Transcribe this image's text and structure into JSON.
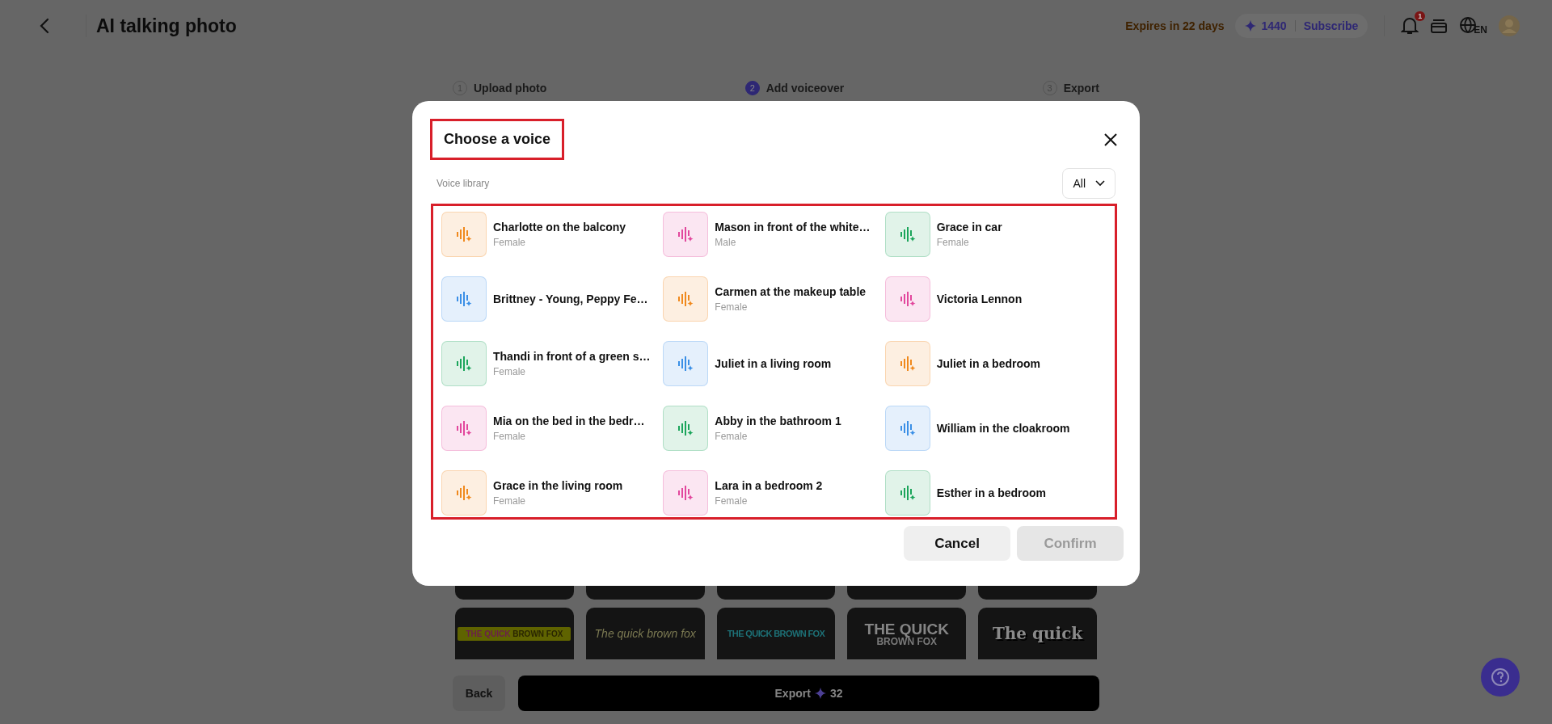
{
  "header": {
    "title": "AI talking photo",
    "expiry": "Expires in 22 days",
    "credits": "1440",
    "subscribe": "Subscribe",
    "notification_count": "1",
    "language": "EN"
  },
  "steps": [
    {
      "number": "1",
      "label": "Upload photo",
      "selected": false
    },
    {
      "number": "2",
      "label": "Add voiceover",
      "selected": true
    },
    {
      "number": "3",
      "label": "Export",
      "selected": false
    }
  ],
  "style_presets": [
    {
      "kind": "highlight",
      "lines": [
        "THE QUICK",
        "BROWN FOX"
      ]
    },
    {
      "kind": "italic",
      "lines": [
        "The quick brown fox"
      ]
    },
    {
      "kind": "condensed",
      "lines": [
        "THE QUICK BROWN FOX"
      ]
    },
    {
      "kind": "stacked",
      "lines": [
        "THE QUICK",
        "BROWN FOX"
      ]
    },
    {
      "kind": "heavy",
      "lines": [
        "The quick"
      ]
    }
  ],
  "back": "Back",
  "export": {
    "label": "Export",
    "cost": "32"
  },
  "dialog": {
    "title": "Choose a voice",
    "library_label": "Voice library",
    "filter": "All",
    "voices": [
      {
        "name": "Charlotte on the balcony",
        "gender": "Female",
        "color": "#f0891d"
      },
      {
        "name": "Mason in front of the white…",
        "gender": "Male",
        "color": "#e2479d"
      },
      {
        "name": "Grace in car",
        "gender": "Female",
        "color": "#1ba55b"
      },
      {
        "name": "Brittney - Young, Peppy Fe…",
        "color": "#3a8fe6"
      },
      {
        "name": "Carmen at the makeup table",
        "gender": "Female",
        "color": "#f0891d"
      },
      {
        "name": "Victoria Lennon",
        "color": "#e2479d"
      },
      {
        "name": "Thandi in front of a green s…",
        "gender": "Female",
        "color": "#1ba55b"
      },
      {
        "name": "Juliet in a living room",
        "color": "#3a8fe6"
      },
      {
        "name": "Juliet in a bedroom",
        "color": "#f0891d"
      },
      {
        "name": "Mia on the bed in the bedr…",
        "gender": "Female",
        "color": "#e2479d"
      },
      {
        "name": "Abby in the bathroom 1",
        "gender": "Female",
        "color": "#1ba55b"
      },
      {
        "name": "William in the cloakroom",
        "color": "#3a8fe6"
      },
      {
        "name": "Grace in the living room",
        "gender": "Female",
        "color": "#f0891d"
      },
      {
        "name": "Lara in a bedroom 2",
        "gender": "Female",
        "color": "#e2479d"
      },
      {
        "name": "Esther in a bedroom",
        "color": "#1ba55b"
      }
    ],
    "cancel": "Cancel",
    "confirm": {
      "label": "Confirm",
      "disabled": true
    }
  }
}
